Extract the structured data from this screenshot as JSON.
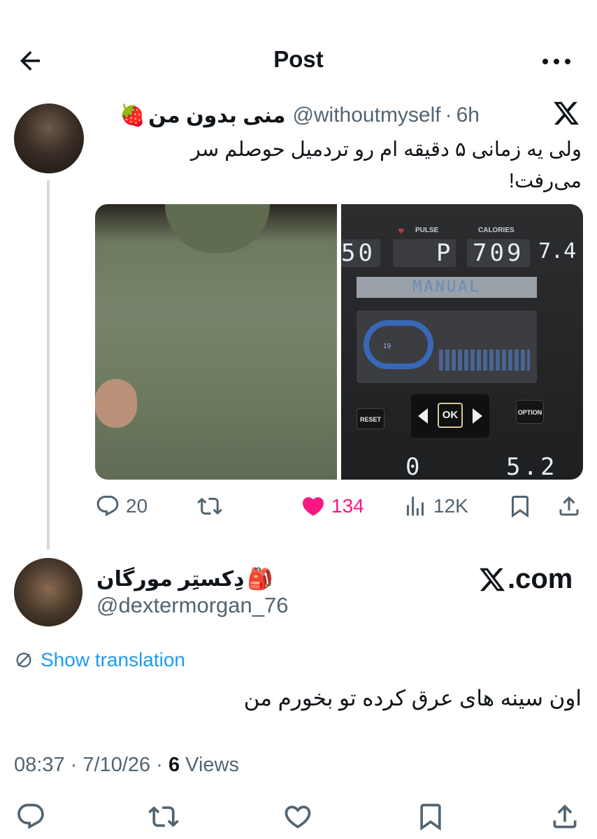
{
  "header": {
    "title": "Post"
  },
  "tweet": {
    "display_name": "منی بدون من",
    "name_emoji": "🍓",
    "handle": "@withoutmyself",
    "separator": "·",
    "time": "6h",
    "text": "ولی یه زمانی ۵ دقیقه ام رو تردمیل حوصلم سر می‌رفت!",
    "media": {
      "pulse_label": "PULSE",
      "calories_label": "CALORIES",
      "left_digits": "50",
      "p_letter": "P",
      "calories_digits": "709",
      "right_digits": "7.4",
      "mode_text": "MANUAL",
      "track_label": "19",
      "reset_label": "RESET",
      "ok_label": "OK",
      "option_label": "OPTION",
      "bottom_left_digits": "0",
      "bottom_right_digits": "5.2"
    },
    "stats": {
      "replies": "20",
      "likes": "134",
      "views": "12K"
    }
  },
  "reply": {
    "display_name": "دِکستِر مورگان",
    "name_emoji": "🎒",
    "handle": "@dextermorgan_76",
    "watermark": ".com",
    "show_translation": "Show translation",
    "text": "اون سینه های عرق کرده تو بخورم من",
    "time": "08:37",
    "separator": "·",
    "date": "7/10/26",
    "views_count": "6",
    "views_label": "Views"
  },
  "colors": {
    "accent": "#1d9bf0",
    "like": "#f91880",
    "secondary_text": "#536471",
    "primary_text": "#0f1419",
    "thread_line": "#cfd9de"
  }
}
